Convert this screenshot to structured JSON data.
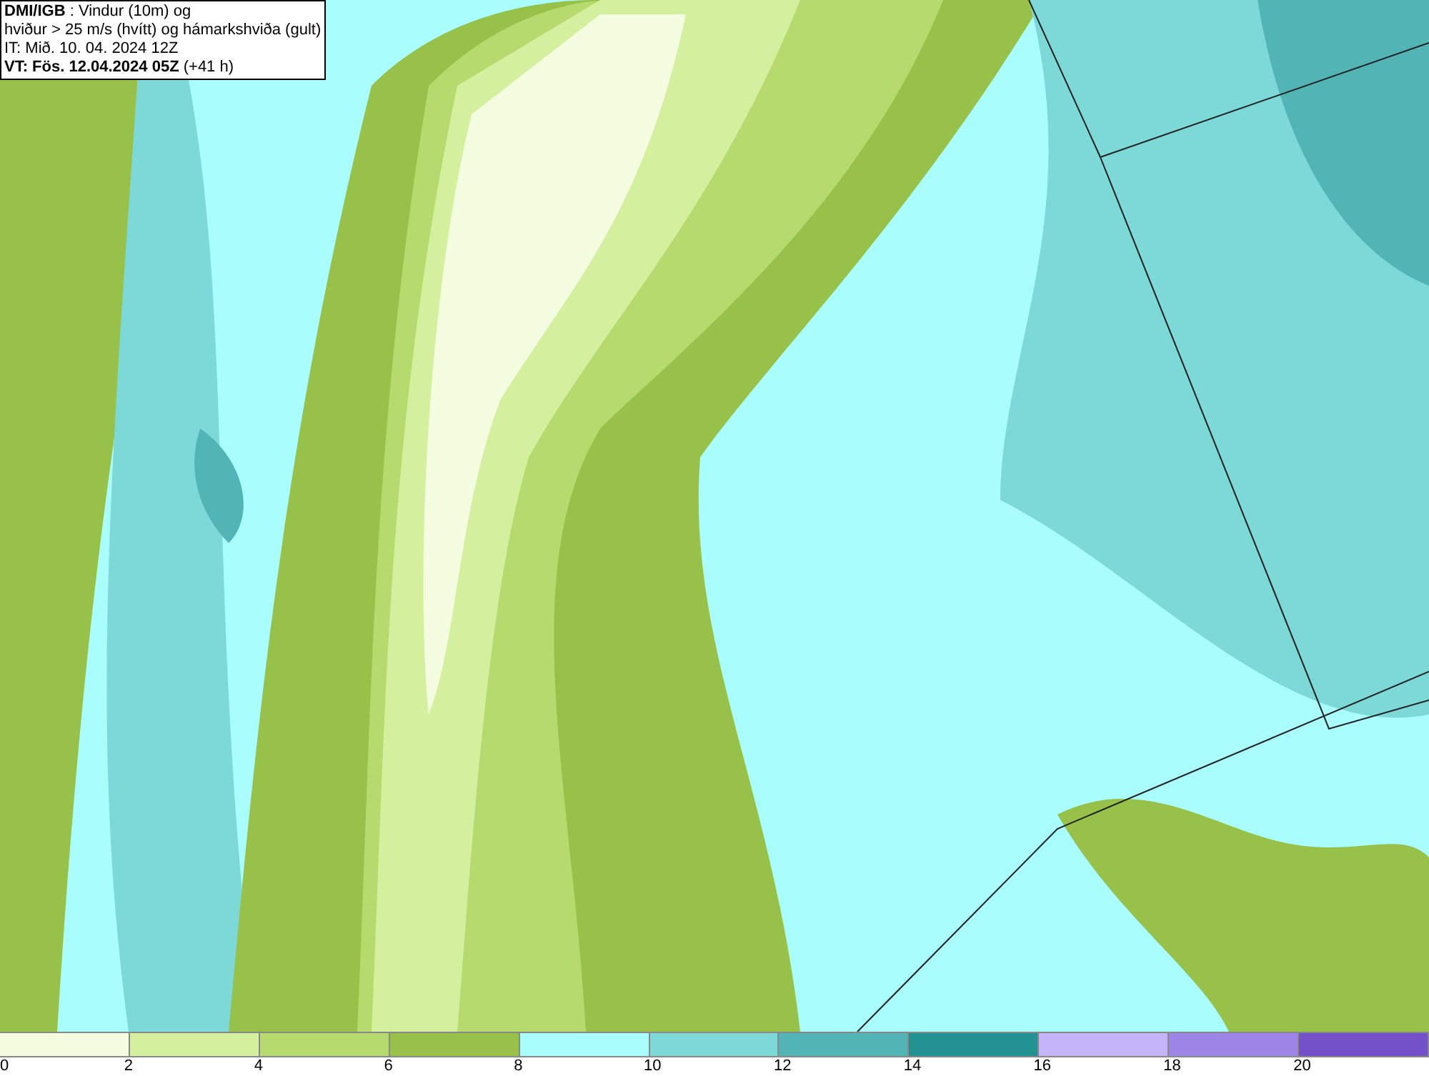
{
  "header": {
    "lines": [
      "**DMI/IGB** : Vindur (10m) og",
      "hviður > 25 m/s (hvítt) og hámarkshviða (gult)",
      "IT: Mið. 10. 04. 2024 12Z",
      "**VT: Fös. 12.04.2024 05Z** (+41 h)"
    ]
  },
  "colorbar": {
    "segments": [
      {
        "color": "#f5fde0"
      },
      {
        "color": "#d4ef9e"
      },
      {
        "color": "#b6da6e"
      },
      {
        "color": "#98c14a"
      },
      {
        "color": "#a9fdfd"
      },
      {
        "color": "#7dd8d8"
      },
      {
        "color": "#52b4b4"
      },
      {
        "color": "#239292"
      },
      {
        "color": "#c5b4f8"
      },
      {
        "color": "#9e86e8"
      },
      {
        "color": "#7451c8"
      }
    ],
    "ticks": [
      "0",
      "2",
      "4",
      "6",
      "8",
      "10",
      "12",
      "14",
      "16",
      "18",
      "20"
    ]
  }
}
